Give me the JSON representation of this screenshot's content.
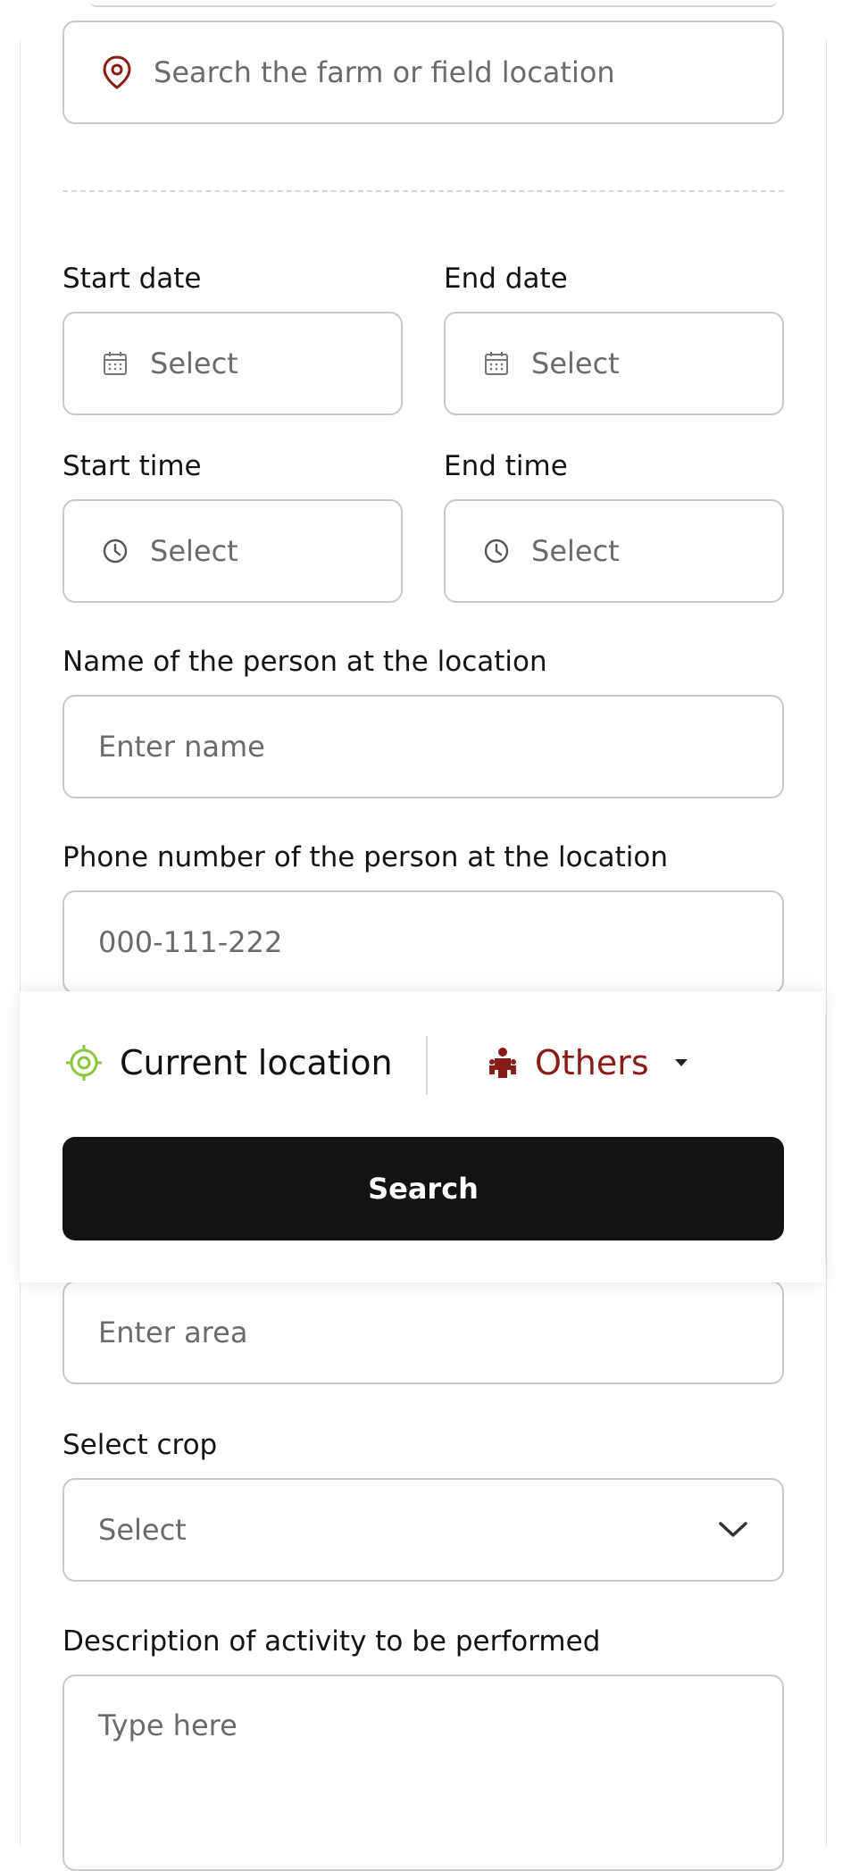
{
  "location_search": {
    "placeholder": "Search the farm or field location"
  },
  "dates": {
    "start_label": "Start date",
    "end_label": "End date",
    "start_placeholder": "Select",
    "end_placeholder": "Select"
  },
  "times": {
    "start_label": "Start time",
    "end_label": "End time",
    "start_placeholder": "Select",
    "end_placeholder": "Select"
  },
  "person_name": {
    "label": "Name of the person at the location",
    "placeholder": "Enter name"
  },
  "person_phone": {
    "label": "Phone number of the person at the location",
    "placeholder": "000-111-222"
  },
  "location_panel": {
    "current_location_label": "Current location",
    "others_label": "Others",
    "search_button": "Search"
  },
  "area": {
    "placeholder": "Enter area"
  },
  "crop": {
    "label": "Select crop",
    "selected": "Select"
  },
  "description": {
    "label": "Description of activity to be performed",
    "placeholder": "Type here"
  },
  "colors": {
    "accent_red": "#8a1c17",
    "accent_green": "#8cc63f",
    "button_dark": "#131313"
  },
  "icons": [
    "map-pin-icon",
    "calendar-icon",
    "clock-icon",
    "crosshair-icon",
    "people-icon",
    "caret-down-icon",
    "chevron-down-icon"
  ]
}
